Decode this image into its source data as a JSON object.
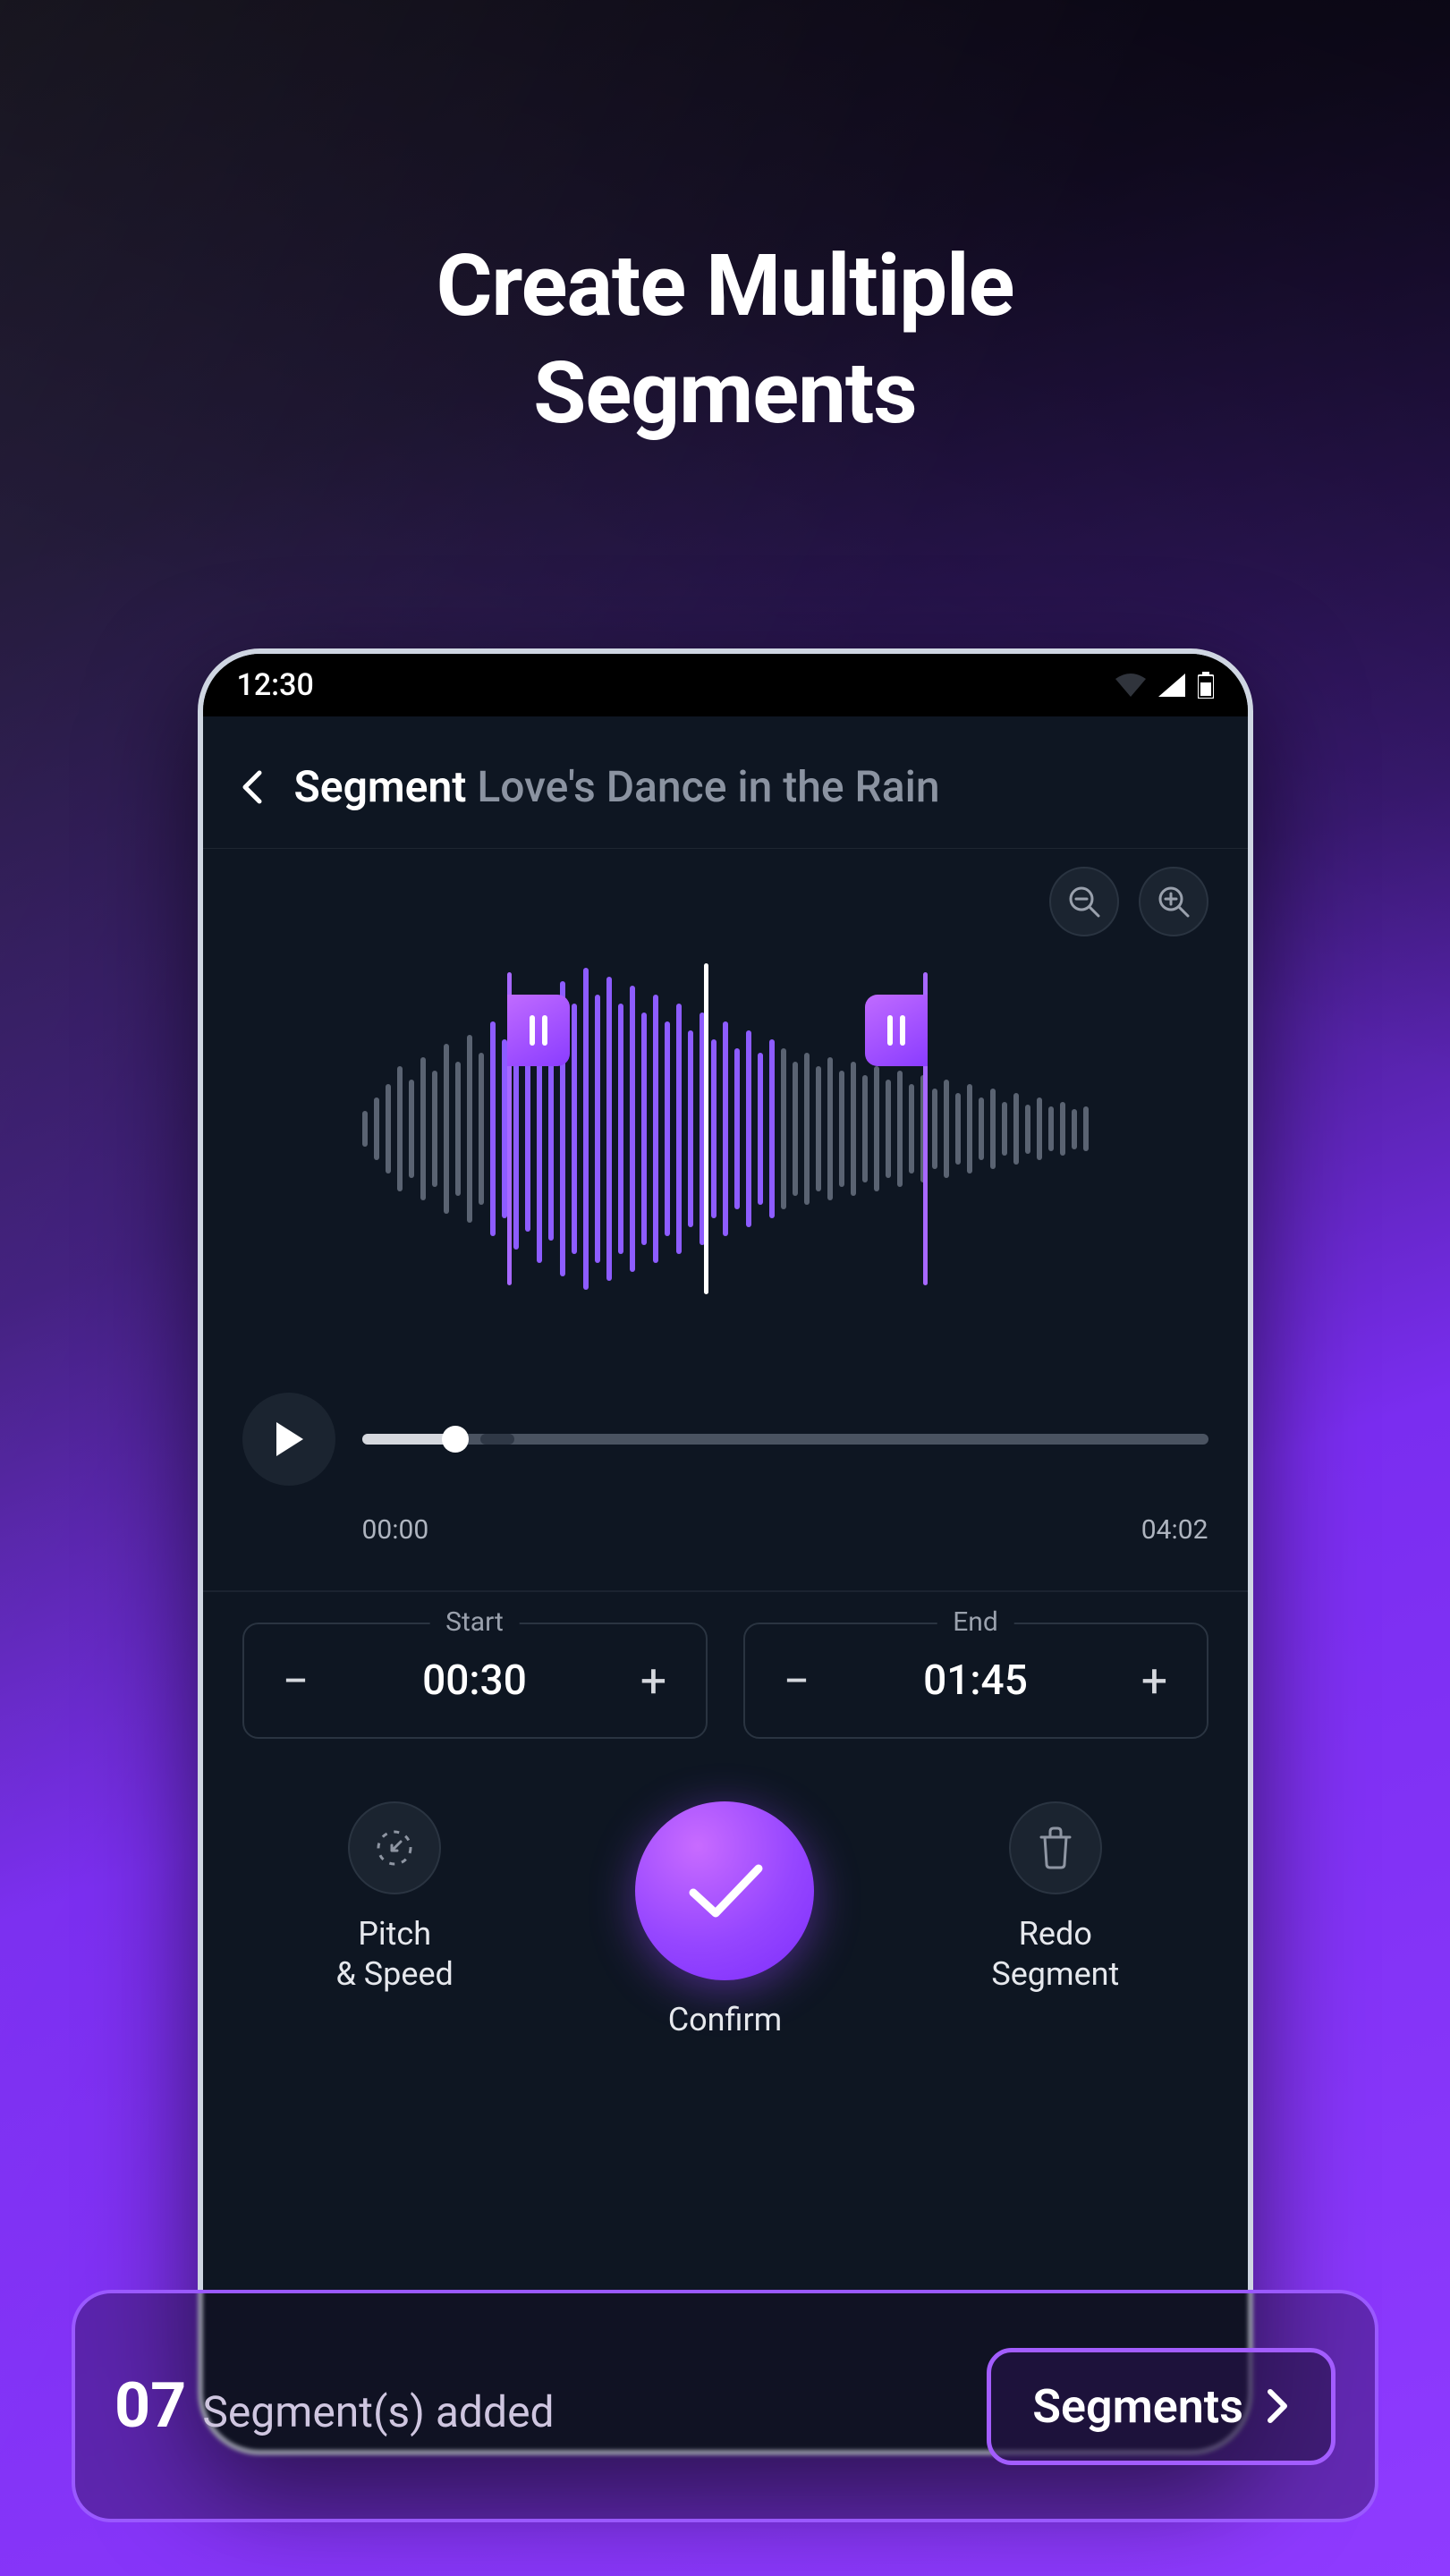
{
  "headline_line1": "Create Multiple",
  "headline_line2": "Segments",
  "status": {
    "time": "12:30"
  },
  "header": {
    "title_strong": "Segment",
    "title_muted": "Love's Dance in the Rain"
  },
  "playback": {
    "current": "00:00",
    "total": "04:02",
    "progress_percent": 11
  },
  "range": {
    "start_label": "Start",
    "end_label": "End",
    "start_value": "00:30",
    "end_value": "01:45",
    "minus": "−",
    "plus": "+"
  },
  "actions": {
    "pitch_label": "Pitch\n& Speed",
    "confirm_label": "Confirm",
    "redo_label": "Redo\nSegment"
  },
  "overlay": {
    "count": "07",
    "text": "Segment(s) added",
    "button": "Segments"
  }
}
